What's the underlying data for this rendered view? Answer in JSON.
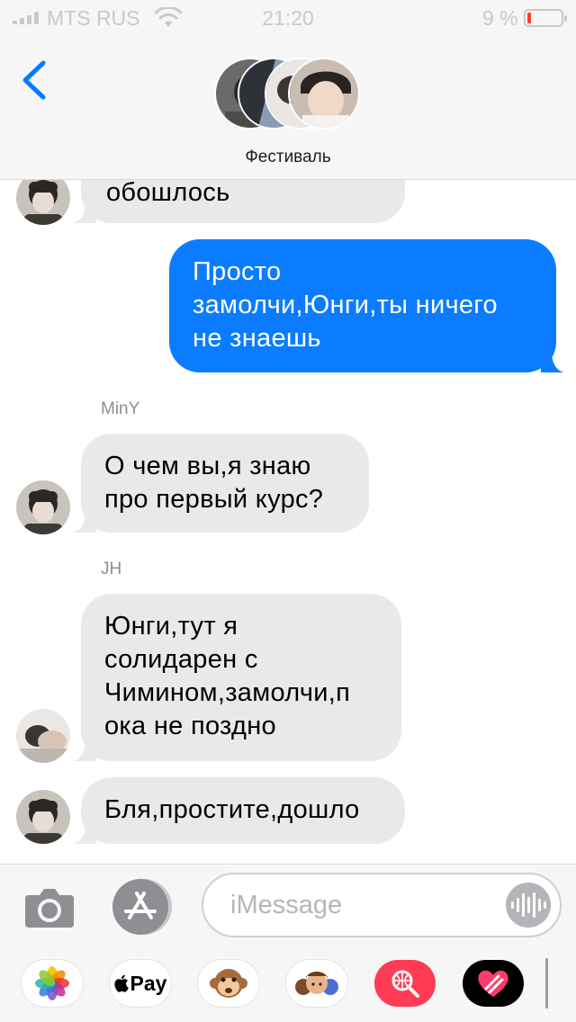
{
  "status_bar": {
    "carrier": "MTS RUS",
    "time": "21:20",
    "battery": "9 %",
    "battery_level": 0.09,
    "colors": {
      "text": "#c9c9c9",
      "battery_low": "#ff3b30"
    }
  },
  "header": {
    "back_icon": "chevron-left-icon",
    "group_name": "Фестиваль",
    "participant_avatar_count": 4
  },
  "messages": [
    {
      "id": "m1",
      "direction": "incoming",
      "sender": "",
      "lines": [
        "обошлось"
      ]
    },
    {
      "id": "m2",
      "direction": "outgoing",
      "lines": [
        "Просто",
        "замолчи,Юнги,ты ничего",
        "не знаешь"
      ]
    },
    {
      "id": "m3",
      "direction": "incoming",
      "sender": "MinY",
      "lines": [
        "О чем вы,я знаю",
        "про первый курс?"
      ]
    },
    {
      "id": "m4",
      "direction": "incoming",
      "sender": "JH",
      "lines": [
        "Юнги,тут я",
        "солидарен с",
        "Чимином,замолчи,п",
        "ока не поздно"
      ]
    },
    {
      "id": "m5",
      "direction": "incoming",
      "sender": "",
      "lines": [
        "Бля,простите,дошло"
      ]
    }
  ],
  "composer": {
    "placeholder": "iMessage",
    "camera_icon": "camera-icon",
    "appstore_icon": "app-store-icon",
    "audio_icon": "waveform-icon"
  },
  "app_drawer": [
    {
      "name": "photos",
      "icon": "photos-icon"
    },
    {
      "name": "apple-pay",
      "label": "Pay",
      "icon": "apple-pay-icon"
    },
    {
      "name": "animoji",
      "icon": "monkey-icon"
    },
    {
      "name": "memoji",
      "icon": "memoji-icon"
    },
    {
      "name": "images-search",
      "icon": "globe-search-icon"
    },
    {
      "name": "digital-touch",
      "icon": "heart-touch-icon"
    }
  ],
  "colors": {
    "outgoing_bubble": "#0b7cff",
    "incoming_bubble": "#e9e9eb",
    "accent": "#007aff"
  }
}
